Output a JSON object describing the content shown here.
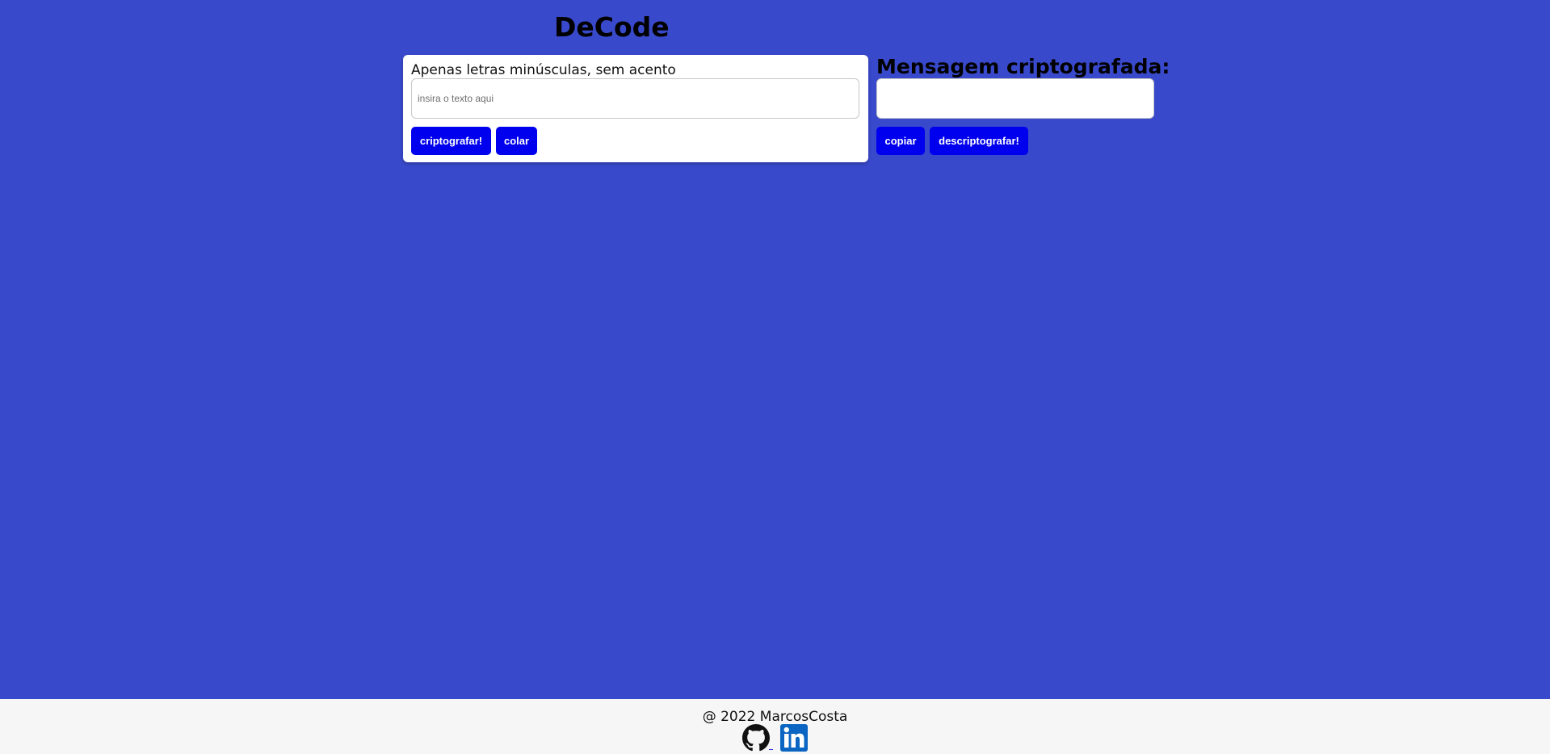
{
  "header": {
    "title": "DeCode"
  },
  "encrypt_panel": {
    "label": "Apenas letras minúsculas, sem acento",
    "input": {
      "placeholder": "insira o texto aqui",
      "value": ""
    },
    "buttons": {
      "encrypt_label": "criptografar!",
      "paste_label": "colar"
    }
  },
  "result_panel": {
    "title": "Mensagem criptografada:",
    "output_value": "",
    "buttons": {
      "copy_label": "copiar",
      "decrypt_label": "descriptografar!"
    }
  },
  "footer": {
    "text": "@ 2022 MarcosCosta",
    "links": [
      {
        "icon": "github-icon"
      },
      {
        "icon": "linkedin-icon"
      }
    ]
  },
  "colors": {
    "background": "#3949cc",
    "button": "#0000ee",
    "panel": "#ffffff",
    "footer": "#f6f6f6",
    "linkedin": "#0a66c2"
  }
}
